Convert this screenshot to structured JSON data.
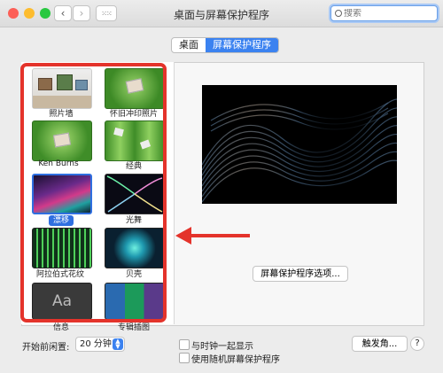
{
  "window": {
    "title": "桌面与屏幕保护程序"
  },
  "search": {
    "placeholder": "搜索"
  },
  "tabs": [
    {
      "label": "桌面"
    },
    {
      "label": "屏幕保护程序"
    }
  ],
  "screensavers": [
    {
      "label": "照片墙"
    },
    {
      "label": "怀旧冲印照片"
    },
    {
      "label": "Ken Burns"
    },
    {
      "label": "经典"
    },
    {
      "label": "漂移",
      "selected": true
    },
    {
      "label": "光舞"
    },
    {
      "label": "阿拉伯式花纹"
    },
    {
      "label": "贝壳"
    },
    {
      "label": "信息",
      "thumb_text": "Aa"
    },
    {
      "label": "专辑插图"
    }
  ],
  "options_button": "屏幕保护程序选项...",
  "start_after": {
    "label": "开始前闲置:",
    "value": "20 分钟"
  },
  "show_with_clock": {
    "label": "与时钟一起显示",
    "checked": false
  },
  "random": {
    "label": "使用随机屏幕保护程序",
    "checked": false
  },
  "hot_corners": "触发角...",
  "help": "?",
  "colors": {
    "accent": "#3b82f0",
    "annotation_red": "#e4332b"
  }
}
